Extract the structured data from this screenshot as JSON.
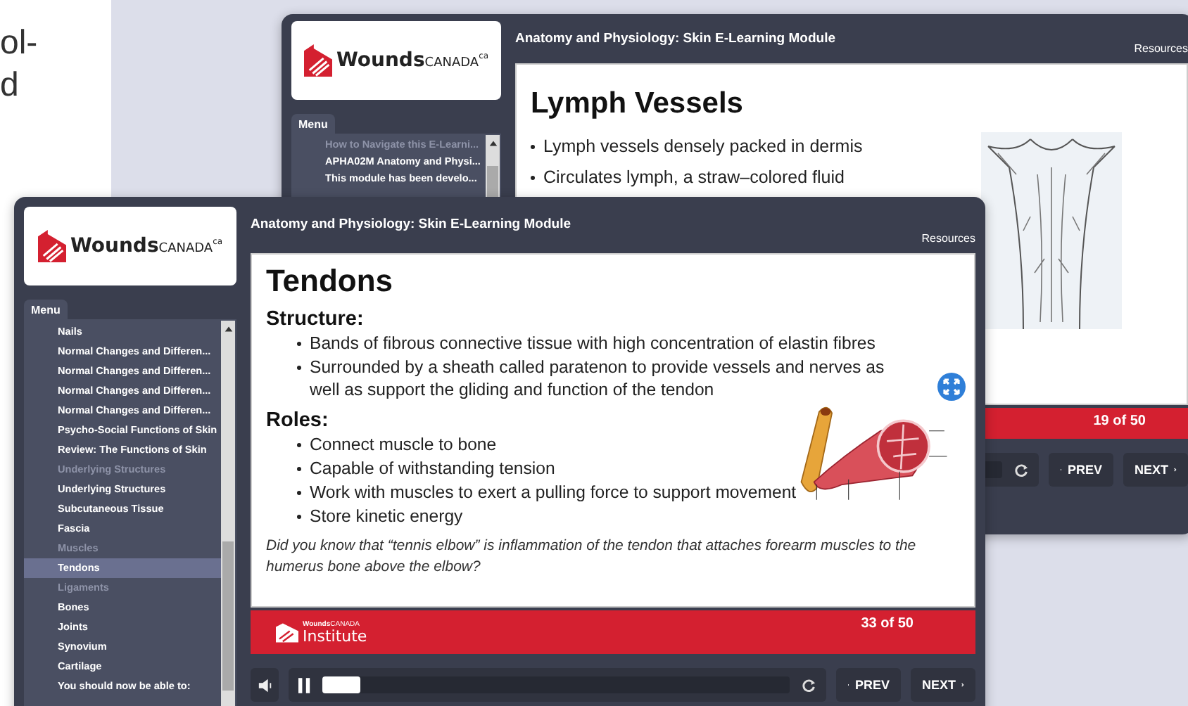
{
  "left_text": [
    "ol-",
    "d"
  ],
  "windows": [
    {
      "logo": {
        "bold": "Wounds",
        "rest": "CANADA",
        "sup": "ca"
      },
      "menu_label": "Menu",
      "menu_items": [
        {
          "label": "How to Navigate this E-Learni...",
          "dimmed": true,
          "selected": false
        },
        {
          "label": "APHA02M Anatomy and Physi...",
          "dimmed": false,
          "selected": false
        },
        {
          "label": "This module has been develo...",
          "dimmed": false,
          "selected": false
        }
      ],
      "title": "Anatomy and Physiology: Skin E-Learning Module",
      "resources": "Resources",
      "slide": {
        "heading": "Lymph Vessels",
        "kind": "lymph",
        "sections": [
          {
            "bullets": [
              "Lymph vessels densely packed in dermis",
              "Circulates lymph, a straw–colored fluid"
            ]
          }
        ]
      },
      "page_counter": "19 of 50",
      "prev": "PREV",
      "next": "NEXT"
    },
    {
      "logo": {
        "bold": "Wounds",
        "rest": "CANADA",
        "sup": "ca"
      },
      "menu_label": "Menu",
      "menu_items": [
        {
          "label": "Nails",
          "dimmed": false,
          "selected": false
        },
        {
          "label": "Normal Changes and Differen...",
          "dimmed": false,
          "selected": false
        },
        {
          "label": "Normal Changes and Differen...",
          "dimmed": false,
          "selected": false
        },
        {
          "label": "Normal Changes and Differen...",
          "dimmed": false,
          "selected": false
        },
        {
          "label": "Normal Changes and Differen...",
          "dimmed": false,
          "selected": false
        },
        {
          "label": "Psycho-Social Functions of Skin",
          "dimmed": false,
          "selected": false
        },
        {
          "label": "Review: The Functions of Skin",
          "dimmed": false,
          "selected": false
        },
        {
          "label": "Underlying Structures",
          "dimmed": true,
          "selected": false
        },
        {
          "label": "Underlying Structures",
          "dimmed": false,
          "selected": false
        },
        {
          "label": "Subcutaneous Tissue",
          "dimmed": false,
          "selected": false
        },
        {
          "label": "Fascia",
          "dimmed": false,
          "selected": false
        },
        {
          "label": "Muscles",
          "dimmed": true,
          "selected": false
        },
        {
          "label": "Tendons",
          "dimmed": false,
          "selected": true
        },
        {
          "label": "Ligaments",
          "dimmed": true,
          "selected": false
        },
        {
          "label": "Bones",
          "dimmed": false,
          "selected": false
        },
        {
          "label": "Joints",
          "dimmed": false,
          "selected": false
        },
        {
          "label": "Synovium",
          "dimmed": false,
          "selected": false
        },
        {
          "label": "Cartilage",
          "dimmed": false,
          "selected": false
        },
        {
          "label": "You should now be able to:",
          "dimmed": false,
          "selected": false
        }
      ],
      "title": "Anatomy and Physiology: Skin E-Learning Module",
      "resources": "Resources",
      "slide": {
        "heading": "Tendons",
        "kind": "tendon",
        "sections": [
          {
            "heading": "Structure:",
            "bullets": [
              "Bands of fibrous connective tissue with high concentration of elastin fibres",
              "Surrounded by a sheath called paratenon to provide vessels and nerves as well as support the gliding and function of the tendon"
            ]
          },
          {
            "heading": "Roles:",
            "bullets": [
              "Connect muscle to bone",
              "Capable of withstanding tension",
              "Work with muscles to exert a pulling force to support movement",
              "Store kinetic energy"
            ]
          }
        ],
        "note": "Did you know that “tennis elbow” is inflammation of the tendon that attaches forearm muscles to the humerus bone above the elbow?"
      },
      "footer_logo": {
        "brand": "Wounds",
        "brand_rest": "CANADA",
        "name": "Institute"
      },
      "page_counter": "33 of 50",
      "progress": {
        "level": 0.08
      },
      "prev": "PREV",
      "next": "NEXT"
    }
  ]
}
